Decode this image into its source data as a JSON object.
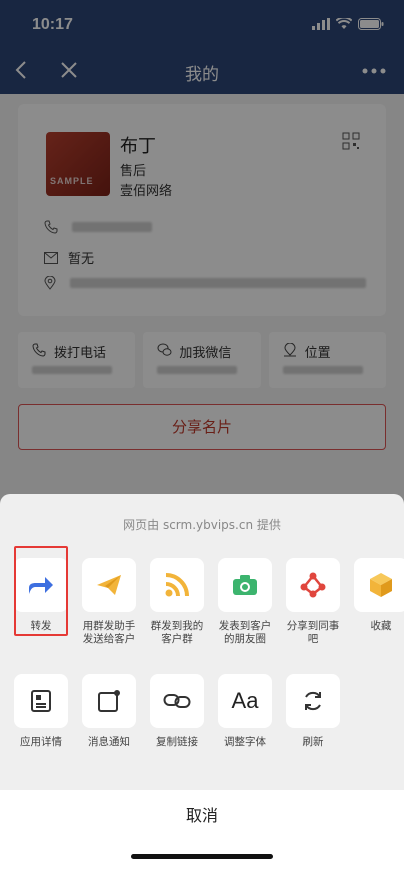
{
  "status_bar": {
    "time": "10:17"
  },
  "nav": {
    "title": "我的"
  },
  "profile": {
    "name": "布丁",
    "role": "售后",
    "company": "壹佰网络",
    "email": "暂无",
    "avatar_watermark": "SAMPLE"
  },
  "actions": [
    {
      "label": "拨打电话",
      "icon": "phone-icon"
    },
    {
      "label": "加我微信",
      "icon": "wechat-icon"
    },
    {
      "label": "位置",
      "icon": "location-icon"
    }
  ],
  "share_card_button": "分享名片",
  "share_sheet": {
    "provider": "网页由 scrm.ybvips.cn 提供",
    "row1": [
      {
        "label": "转发",
        "icon": "forward-arrow-icon",
        "color": "#3d6fe0"
      },
      {
        "label": "用群发助手发送给客户",
        "icon": "paper-plane-icon",
        "color": "#f2b43a"
      },
      {
        "label": "群发到我的客户群",
        "icon": "rss-icon",
        "color": "#f2b43a"
      },
      {
        "label": "发表到客户的朋友圈",
        "icon": "camera-icon",
        "color": "#3cb46e"
      },
      {
        "label": "分享到同事吧",
        "icon": "share-nodes-icon",
        "color": "#e0463d"
      },
      {
        "label": "收藏",
        "icon": "cube-icon",
        "color": "#f2b43a"
      }
    ],
    "row2": [
      {
        "label": "应用详情",
        "icon": "document-icon"
      },
      {
        "label": "消息通知",
        "icon": "notification-icon"
      },
      {
        "label": "复制链接",
        "icon": "link-icon"
      },
      {
        "label": "调整字体",
        "icon": "font-icon"
      },
      {
        "label": "刷新",
        "icon": "refresh-icon"
      }
    ],
    "cancel": "取消"
  }
}
